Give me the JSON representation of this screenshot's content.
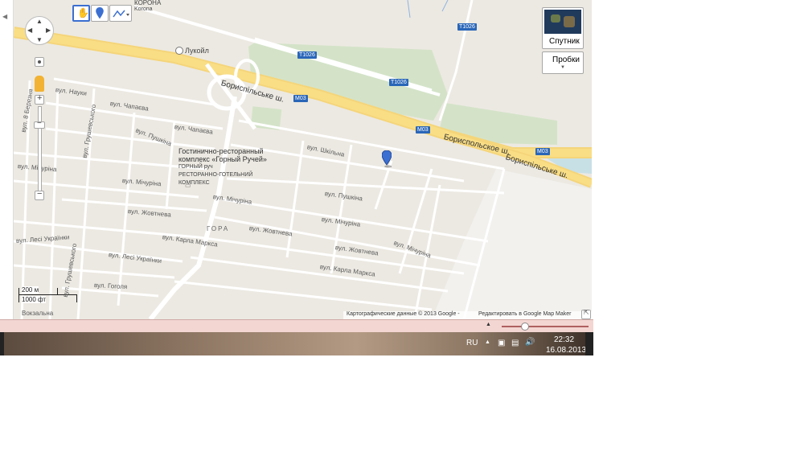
{
  "controls": {
    "satellite_label": "Спутник",
    "traffic_label": "Пробки"
  },
  "map": {
    "highway_upper": "Бориспільське ш.",
    "highway_ru": "Бориспольское ш.",
    "highway_lower": "Бориспільське ш.",
    "shield_m03_a": "M03",
    "shield_m03_b": "M03",
    "shield_m03_c": "M03",
    "shield_t1026_a": "T1026",
    "shield_t1026_b": "T1026",
    "shield_t1026_c": "T1026",
    "town_top": "КОРОНА",
    "town_top_sub": "Korona",
    "gas_station": "Лукойл",
    "poi_lines": [
      "Гостинично-ресторанный",
      "комплекс «Горный Ручей»",
      "ГОРНЫЙ руч",
      "РЕСТОРАННО-ГОТЕЛЬНИЙ",
      "КОМПЛЕКС"
    ],
    "district": "ГОРА",
    "streets": {
      "nauky": "вул. Науки",
      "chapaeva1": "вул. Чапаєва",
      "chapaeva2": "вул. Чапаєва",
      "pushkina1": "вул. Пушкіна",
      "pushkina2": "вул. Пушкіна",
      "shkilna": "вул. Шкільна",
      "michurina1": "вул. Мічуріна",
      "michurina2": "вул. Мічуріна",
      "michurina3": "вул. Мічуріна",
      "michurina4": "вул. Мічуріна",
      "michurina5": "вул. Мічуріна",
      "zhovtneva1": "вул. Жовтнева",
      "zhovtneva2": "вул. Жовтнева",
      "zhovtneva3": "вул. Жовтнева",
      "karla1": "вул. Карла Маркса",
      "karla2": "вул. Карла Маркса",
      "lesi1": "вул. Лесі Українки",
      "lesi2": "вул. Лесі Українки",
      "gogolya": "вул. Гоголя",
      "hrushevskoho1": "вул. Грушевського",
      "hrushevskoho2": "вул. Грушевського",
      "berezniya": "вул. 8 Березня",
      "vokzalna": "Вокзальна"
    },
    "scale_metric": "200 м",
    "scale_imperial": "1000 фт",
    "attribution": "Картографические данные © 2013 Google -",
    "edit_link": "Редактировать в Google Map Maker"
  },
  "taskbar": {
    "language": "RU",
    "time": "22:32",
    "date": "16.08.2013",
    "slider_value": 0.28
  }
}
